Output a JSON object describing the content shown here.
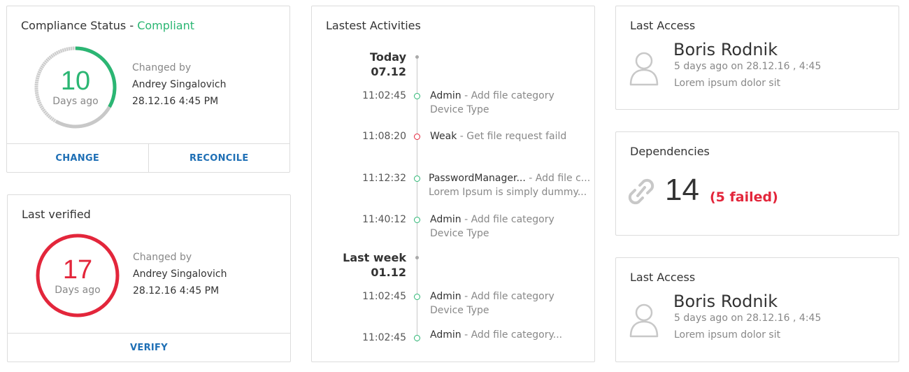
{
  "compliance": {
    "title": "Compliance Status",
    "separator": " - ",
    "status": "Compliant",
    "count": "10",
    "count_unit": "Days ago",
    "changed_by_label": "Changed by",
    "changed_by": "Andrey Singalovich",
    "changed_at": "28.12.16  4:45 PM",
    "progress_fraction": 0.333,
    "change_label": "CHANGE",
    "reconcile_label": "RECONCILE"
  },
  "verified": {
    "title": "Last verified",
    "count": "17",
    "count_unit": "Days ago",
    "changed_by_label": "Changed by",
    "changed_by": "Andrey Singalovich",
    "changed_at": "28.12.16  4:45 PM",
    "verify_label": "VERIFY"
  },
  "activities": {
    "title": "Lastest Activities",
    "groups": [
      {
        "label": "Today",
        "date": "07.12",
        "items": [
          {
            "time": "11:02:45",
            "who": "Admin",
            "sep": "  - ",
            "what": "Add file category",
            "sub": "Device Type",
            "status": "ok"
          },
          {
            "time": "11:08:20",
            "who": "Weak",
            "sep": " - ",
            "what": "Get file request faild",
            "sub": "",
            "status": "error"
          },
          {
            "time": "11:12:32",
            "who": "PasswordManager...",
            "sep": "  - ",
            "what": "Add file c...",
            "sub": "Lorem Ipsum is simply dummy...",
            "status": "ok"
          },
          {
            "time": "11:40:12",
            "who": "Admin",
            "sep": "  - ",
            "what": "Add file category",
            "sub": "Device Type",
            "status": "ok"
          }
        ]
      },
      {
        "label": "Last week",
        "date": "01.12",
        "items": [
          {
            "time": "11:02:45",
            "who": "Admin",
            "sep": "  - ",
            "what": "Add file category",
            "sub": "Device Type",
            "status": "ok"
          },
          {
            "time": "11:02:45",
            "who": "Admin",
            "sep": "  - ",
            "what": "Add file category...",
            "sub": "",
            "status": "ok"
          }
        ]
      }
    ]
  },
  "last_access_1": {
    "title": "Last Access",
    "name": "Boris Rodnik",
    "when": "5 days ago on 28.12.16 , 4:45",
    "note": "Lorem ipsum dolor sit",
    "icon": "user-icon"
  },
  "dependencies": {
    "title": "Dependencies",
    "count": "14",
    "failed": "(5 failed)",
    "icon": "link-icon"
  },
  "last_access_2": {
    "title": "Last Access",
    "name": "Boris Rodnik",
    "when": "5 days ago on 28.12.16 , 4:45",
    "note": "Lorem ipsum dolor sit",
    "icon": "user-icon"
  },
  "colors": {
    "green": "#2bb673",
    "red": "#e3263b",
    "blue": "#1e6fb5",
    "track": "#e8e8e8"
  }
}
